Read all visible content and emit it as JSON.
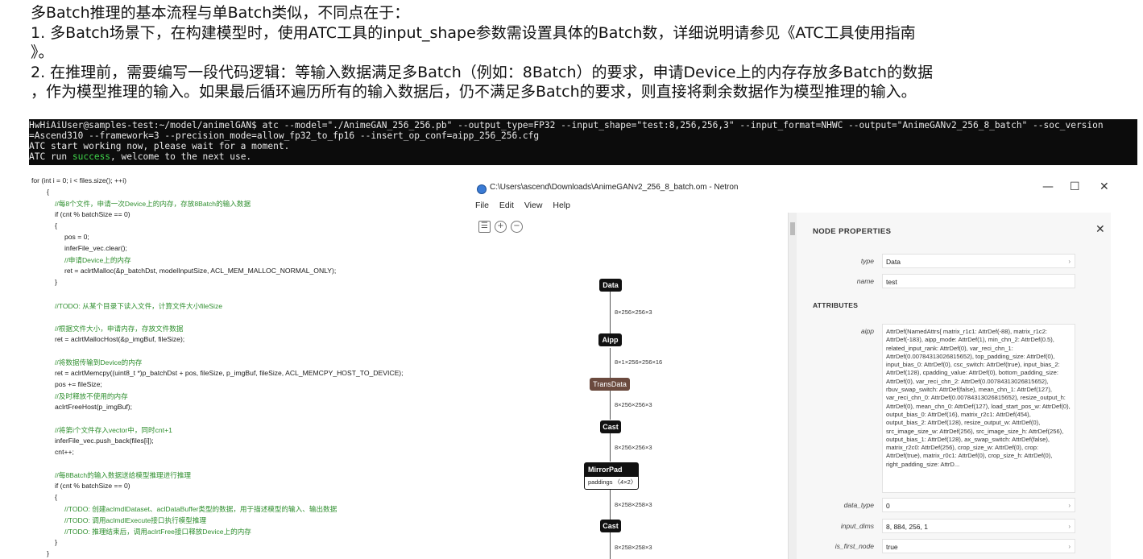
{
  "intro": {
    "line1": "多Batch推理的基本流程与单Batch类似，不同点在于：",
    "line2": "1. 多Batch场景下，在构建模型时，使用ATC工具的input_shape参数需设置具体的Batch数，详细说明请参见《ATC工具使用指南",
    "line3": "》。",
    "line4": "2. 在推理前，需要编写一段代码逻辑：等输入数据满足多Batch（例如：8Batch）的要求，申请Device上的内存存放多Batch的数据",
    "line5": "，作为模型推理的输入。如果最后循环遍历所有的输入数据后，仍不满足多Batch的要求，则直接将剩余数据作为模型推理的输入。"
  },
  "terminal": {
    "line1": "HwHiAiUser@samples-test:~/model/animelGAN$ atc --model=\"./AnimeGAN_256_256.pb\" --output_type=FP32 --input_shape=\"test:8,256,256,3\" --input_format=NHWC --output=\"AnimeGANv2_256_8_batch\" --soc_version",
    "line2": "=Ascend310 --framework=3 --precision_mode=allow_fp32_to_fp16 --insert_op_conf=aipp_256_256.cfg",
    "line3": "ATC start working now, please wait for a moment.",
    "line4_pre": "ATC run ",
    "line4_ok": "success",
    "line4_post": ", welcome to the next use."
  },
  "code": [
    "for (int i = 0; i < files.size(); ++i)",
    "{",
    "//每8个文件，申请一次Device上的内存，存放8Batch的输入数据",
    "if (cnt % batchSize == 0)",
    "{",
    "pos = 0;",
    "inferFile_vec.clear();",
    "//申请Device上的内存",
    "ret = aclrtMalloc(&p_batchDst, modelInputSize, ACL_MEM_MALLOC_NORMAL_ONLY);",
    "}",
    "//TODO: 从某个目录下读入文件，计算文件大小fileSize",
    "//根据文件大小，申请内存，存放文件数据",
    "ret = aclrtMallocHost(&p_imgBuf, fileSize);",
    "//将数据传输到Device的内存",
    "ret = aclrtMemcpy((uint8_t *)p_batchDst + pos, fileSize, p_imgBuf, fileSize, ACL_MEMCPY_HOST_TO_DEVICE);",
    "pos += fileSize;",
    "//及时释放不使用的内存",
    "aclrtFreeHost(p_imgBuf);",
    "//将第i个文件存入vector中，同时cnt+1",
    "inferFile_vec.push_back(files[i]);",
    "cnt++;",
    "//每8Batch的输入数据送给模型推理进行推理",
    "if (cnt % batchSize == 0)",
    "{",
    "//TODO: 创建aclmdlDataset、aclDataBuffer类型的数据，用于描述模型的输入、输出数据",
    "//TODO: 调用aclmdlExecute接口执行模型推理",
    "//TODO: 推理结束后，调用aclrtFree接口释放Device上的内存",
    "}",
    "}"
  ],
  "netron": {
    "title": "C:\\Users\\ascend\\Downloads\\AnimeGANv2_256_8_batch.om - Netron",
    "win_min": "—",
    "win_max": "☐",
    "win_close": "✕",
    "menu": [
      "File",
      "Edit",
      "View",
      "Help"
    ],
    "tools": [
      "☰",
      "+",
      "−"
    ],
    "nodes": {
      "data": "Data",
      "aipp": "Aipp",
      "transdata": "TransData",
      "cast1": "Cast",
      "mirrorpad": "MirrorPad",
      "mirrorpad_attr": "paddings 〈4×2〉",
      "cast2": "Cast"
    },
    "edges": [
      "8×256×256×3",
      "8×1×256×256×16",
      "8×256×256×3",
      "8×256×256×3",
      "8×258×258×3",
      "8×258×258×3"
    ],
    "panel": {
      "title": "NODE PROPERTIES",
      "close": "✕",
      "type_label": "type",
      "type_value": "Data",
      "name_label": "name",
      "name_value": "test",
      "attributes_heading": "ATTRIBUTES",
      "aipp_label": "aipp",
      "aipp_value": "AttrDef(NamedAttrs{ matrix_r1c1: AttrDef(-88), matrix_r1c2: AttrDef(-183), aipp_mode: AttrDef(1), min_chn_2: AttrDef(0.5), related_input_rank: AttrDef(0), var_reci_chn_1: AttrDef(0.00784313026815652), top_padding_size: AttrDef(0), input_bias_0: AttrDef(0), csc_switch: AttrDef(true), input_bias_2: AttrDef(128), cpadding_value: AttrDef(0), bottom_padding_size: AttrDef(0), var_reci_chn_2: AttrDef(0.00784313026815652), rbuv_swap_switch: AttrDef(false), mean_chn_1: AttrDef(127), var_reci_chn_0: AttrDef(0.00784313026815652), resize_output_h: AttrDef(0), mean_chn_0: AttrDef(127), load_start_pos_w: AttrDef(0), output_bias_0: AttrDef(16), matrix_r2c1: AttrDef(454), output_bias_2: AttrDef(128), resize_output_w: AttrDef(0), src_image_size_w: AttrDef(256), src_image_size_h: AttrDef(256), output_bias_1: AttrDef(128), ax_swap_switch: AttrDef(false), matrix_r2c0: AttrDef(256), crop_size_w: AttrDef(0), crop: AttrDef(true), matrix_r0c1: AttrDef(0), crop_size_h: AttrDef(0), right_padding_size: AttrD...",
      "data_type_label": "data_type",
      "data_type_value": "0",
      "input_dims_label": "input_dims",
      "input_dims_value": "8, 884, 256, 1",
      "is_first_node_label": "is_first_node",
      "is_first_node_value": "true"
    }
  },
  "colors": {
    "terminal_bg": "#0c0c0c",
    "success": "#3fd44a",
    "comment": "#2f8f2f",
    "transdata": "#6b4a3e"
  }
}
